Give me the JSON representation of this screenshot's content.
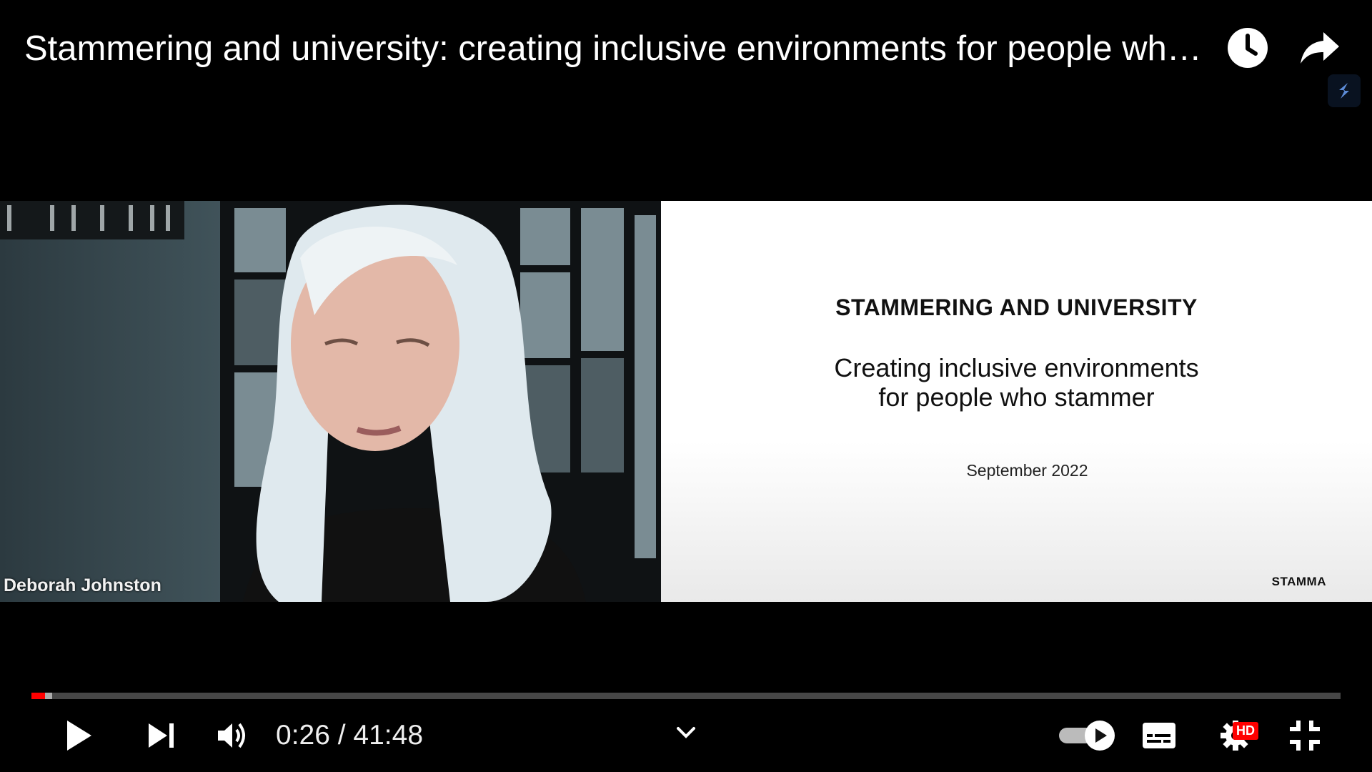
{
  "video": {
    "title": "Stammering and university: creating inclusive environments for people who stammer",
    "speaker_name": "Deborah Johnston"
  },
  "slide": {
    "heading": "STAMMERING AND UNIVERSITY",
    "subtitle_line1": "Creating inclusive environments",
    "subtitle_line2": "for people who stammer",
    "date": "September 2022",
    "logo_text": "STAMMA"
  },
  "player": {
    "current_time": "0:26",
    "separator": " / ",
    "duration": "41:48",
    "progress_fraction": 0.0104,
    "buffered_fraction": 0.0156,
    "quality_badge": "HD",
    "autoplay_on": true
  },
  "icons": {
    "watch_later": "clock-icon",
    "share": "share-icon",
    "extension": "extension-icon",
    "play": "play-icon",
    "next": "next-icon",
    "volume": "volume-icon",
    "chevron": "chevron-down-icon",
    "autoplay": "autoplay-toggle-icon",
    "subtitles": "subtitles-icon",
    "settings": "gear-icon",
    "exit_fullscreen": "exit-fullscreen-icon"
  },
  "colors": {
    "progress_played": "#ff0000",
    "background": "#000000",
    "hd_badge": "#ff0000"
  }
}
